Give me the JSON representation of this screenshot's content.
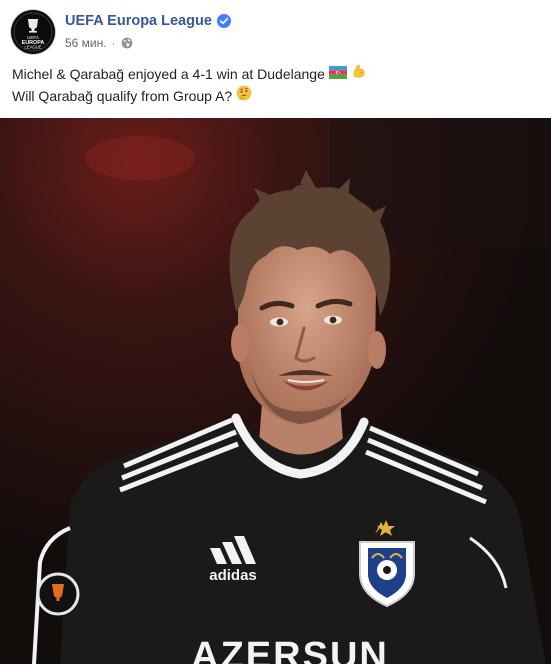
{
  "post": {
    "page_name": "UEFA Europa League",
    "timestamp": "56 мин.",
    "separator": "·",
    "caption_line1": "Michel & Qarabağ enjoyed a 4-1 win at Dudelange",
    "caption_line2": "Will Qarabağ qualify from Group A?",
    "avatar_logo_text_top": "UEFA",
    "avatar_logo_text_main": "EUROPA",
    "avatar_logo_text_bottom": "LEAGUE",
    "photo": {
      "kit_brand": "adidas",
      "sponsor_text": "AZERSUN"
    }
  },
  "icons": {
    "verified": "verified-badge-icon",
    "privacy": "globe-icon",
    "emoji_1": "azerbaijan-flag-emoji",
    "emoji_2": "flexed-biceps-emoji",
    "emoji_3": "thinking-face-emoji"
  },
  "colors": {
    "page_name": "#385898",
    "verified": "#4080ff",
    "meta_text": "#616770",
    "body_text": "#1d2129"
  }
}
